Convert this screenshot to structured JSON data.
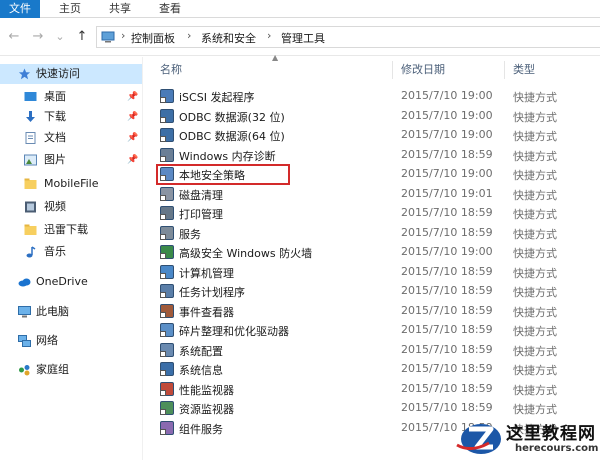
{
  "ribbon": {
    "tabs": [
      "文件",
      "主页",
      "共享",
      "查看"
    ],
    "active_tab": "文件",
    "accent": "#1979ca"
  },
  "nav": {
    "back": "←",
    "forward": "→",
    "recent": "⌄",
    "up": "↑",
    "breadcrumb": [
      "控制面板",
      "系统和安全",
      "管理工具"
    ],
    "separator": "›"
  },
  "sidebar": {
    "items": [
      {
        "label": "快速访问",
        "icon": "star-icon",
        "pinned": false,
        "selected": true
      },
      {
        "label": "桌面",
        "icon": "desktop-icon",
        "pinned": true
      },
      {
        "label": "下载",
        "icon": "download-icon",
        "pinned": true
      },
      {
        "label": "文档",
        "icon": "document-icon",
        "pinned": true
      },
      {
        "label": "图片",
        "icon": "picture-icon",
        "pinned": true
      },
      {
        "label": "MobileFile",
        "icon": "folder-icon",
        "pinned": false
      },
      {
        "label": "视频",
        "icon": "video-icon",
        "pinned": false
      },
      {
        "label": "迅雷下载",
        "icon": "folder-icon",
        "pinned": false
      },
      {
        "label": "音乐",
        "icon": "music-icon",
        "pinned": false
      },
      {
        "label": "OneDrive",
        "icon": "cloud-icon",
        "pinned": false
      },
      {
        "label": "此电脑",
        "icon": "computer-icon",
        "pinned": false
      },
      {
        "label": "网络",
        "icon": "network-icon",
        "pinned": false
      },
      {
        "label": "家庭组",
        "icon": "homegroup-icon",
        "pinned": false
      }
    ]
  },
  "list": {
    "columns": {
      "name": "名称",
      "date": "修改日期",
      "type": "类型"
    },
    "files": [
      {
        "name": "iSCSI 发起程序",
        "date": "2015/7/10 19:00",
        "type": "快捷方式",
        "icon": "iscsi-icon"
      },
      {
        "name": "ODBC 数据源(32 位)",
        "date": "2015/7/10 19:00",
        "type": "快捷方式",
        "icon": "odbc-icon"
      },
      {
        "name": "ODBC 数据源(64 位)",
        "date": "2015/7/10 19:00",
        "type": "快捷方式",
        "icon": "odbc-icon"
      },
      {
        "name": "Windows 内存诊断",
        "date": "2015/7/10 18:59",
        "type": "快捷方式",
        "icon": "memory-icon"
      },
      {
        "name": "本地安全策略",
        "date": "2015/7/10 19:00",
        "type": "快捷方式",
        "icon": "security-policy-icon",
        "highlighted": true
      },
      {
        "name": "磁盘清理",
        "date": "2015/7/10 19:01",
        "type": "快捷方式",
        "icon": "disk-cleanup-icon"
      },
      {
        "name": "打印管理",
        "date": "2015/7/10 18:59",
        "type": "快捷方式",
        "icon": "printer-icon"
      },
      {
        "name": "服务",
        "date": "2015/7/10 18:59",
        "type": "快捷方式",
        "icon": "services-icon"
      },
      {
        "name": "高级安全 Windows 防火墙",
        "date": "2015/7/10 19:00",
        "type": "快捷方式",
        "icon": "firewall-icon"
      },
      {
        "name": "计算机管理",
        "date": "2015/7/10 18:59",
        "type": "快捷方式",
        "icon": "computer-management-icon"
      },
      {
        "name": "任务计划程序",
        "date": "2015/7/10 18:59",
        "type": "快捷方式",
        "icon": "task-scheduler-icon"
      },
      {
        "name": "事件查看器",
        "date": "2015/7/10 18:59",
        "type": "快捷方式",
        "icon": "event-viewer-icon"
      },
      {
        "name": "碎片整理和优化驱动器",
        "date": "2015/7/10 18:59",
        "type": "快捷方式",
        "icon": "defrag-icon"
      },
      {
        "name": "系统配置",
        "date": "2015/7/10 18:59",
        "type": "快捷方式",
        "icon": "system-config-icon"
      },
      {
        "name": "系统信息",
        "date": "2015/7/10 18:59",
        "type": "快捷方式",
        "icon": "system-info-icon"
      },
      {
        "name": "性能监视器",
        "date": "2015/7/10 18:59",
        "type": "快捷方式",
        "icon": "performance-icon"
      },
      {
        "name": "资源监视器",
        "date": "2015/7/10 18:59",
        "type": "快捷方式",
        "icon": "resource-monitor-icon"
      },
      {
        "name": "组件服务",
        "date": "2015/7/10 18:59",
        "type": "快捷方式",
        "icon": "component-services-icon"
      }
    ],
    "highlight_color": "#d32a2a"
  },
  "watermark": {
    "title": "这里教程网",
    "url": "herecours.com"
  }
}
